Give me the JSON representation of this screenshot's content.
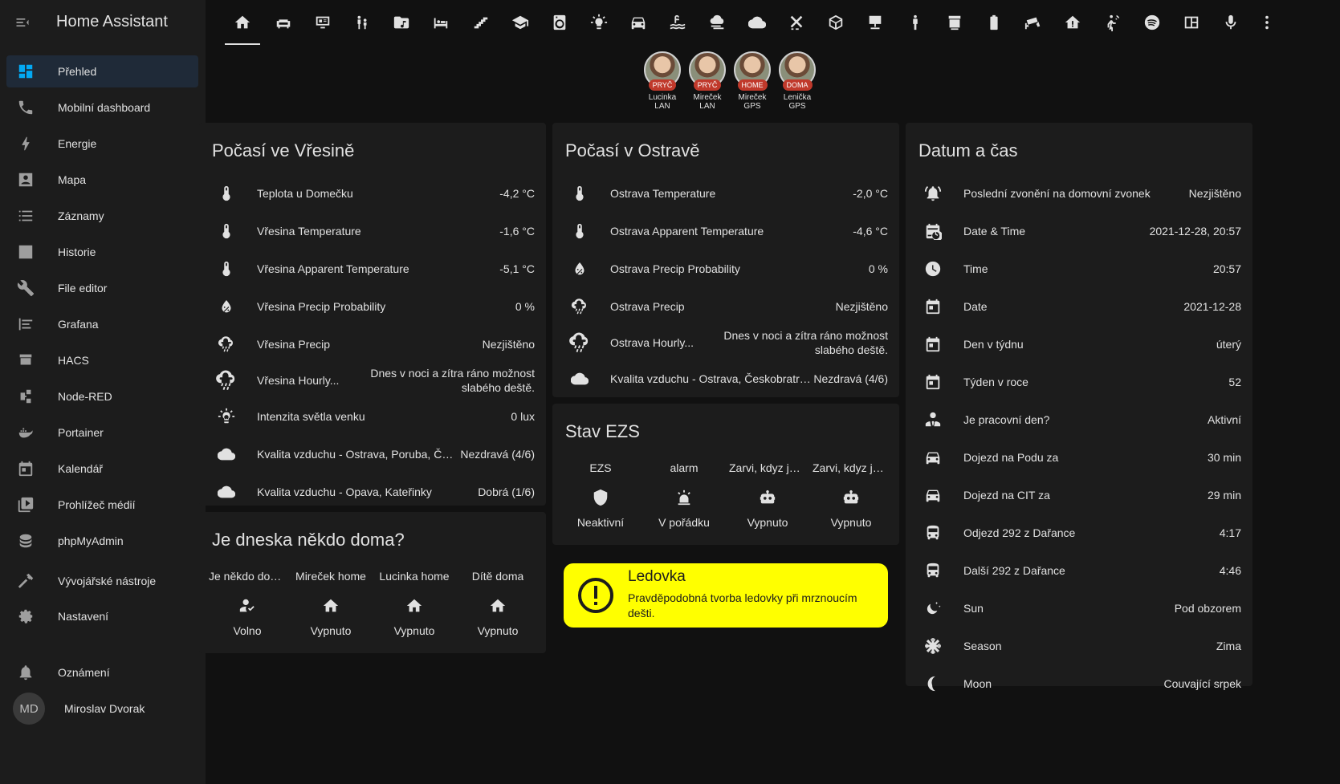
{
  "app": {
    "title": "Home Assistant"
  },
  "sidebar": {
    "items": [
      {
        "label": "Přehled",
        "icon": "dashboard-icon",
        "active": true
      },
      {
        "label": "Mobilní dashboard",
        "icon": "phone-icon"
      },
      {
        "label": "Energie",
        "icon": "lightning-icon"
      },
      {
        "label": "Mapa",
        "icon": "map-icon"
      },
      {
        "label": "Záznamy",
        "icon": "list-icon"
      },
      {
        "label": "Historie",
        "icon": "chart-icon"
      },
      {
        "label": "File editor",
        "icon": "wrench-icon"
      },
      {
        "label": "Grafana",
        "icon": "grafana-icon"
      },
      {
        "label": "HACS",
        "icon": "hacs-icon"
      },
      {
        "label": "Node-RED",
        "icon": "node-red-icon"
      },
      {
        "label": "Portainer",
        "icon": "whale-icon"
      },
      {
        "label": "Kalendář",
        "icon": "calendar-icon"
      },
      {
        "label": "Prohlížeč médií",
        "icon": "media-icon"
      },
      {
        "label": "phpMyAdmin",
        "icon": "database-icon"
      }
    ],
    "dev_tools": "Vývojářské nástroje",
    "settings": "Nastavení",
    "notifications": "Oznámení",
    "user_initials": "MD",
    "user_name": "Miroslav Dvorak"
  },
  "tabs": [
    "home-icon",
    "sofa-icon",
    "monitor-icon",
    "family-icon",
    "music-folder-icon",
    "bed-icon",
    "stairs-icon",
    "school-icon",
    "washer-icon",
    "bulb-icon",
    "car-icon",
    "pool-icon",
    "weather-wind-icon",
    "cloud-icon",
    "air-conditioner-icon",
    "cube-icon",
    "desk-icon",
    "person-icon",
    "printer-3d-icon",
    "battery-icon",
    "cctv-icon",
    "house-alert-icon",
    "motion-sensor-icon",
    "spotify-icon",
    "panel-icon",
    "microphone-icon"
  ],
  "badges": [
    {
      "state": "PRYČ",
      "name1": "Lucinka",
      "name2": "LAN"
    },
    {
      "state": "PRYČ",
      "name1": "Mireček",
      "name2": "LAN"
    },
    {
      "state": "HOME",
      "name1": "Mireček",
      "name2": "GPS"
    },
    {
      "state": "DOMA",
      "name1": "Lenička",
      "name2": "GPS"
    }
  ],
  "weather_vresina": {
    "title": "Počasí ve Vřesině",
    "rows": [
      {
        "icon": "thermometer-icon",
        "label": "Teplota u Domečku",
        "value": "-4,2 °C"
      },
      {
        "icon": "thermometer-icon",
        "label": "Vřesina Temperature",
        "value": "-1,6 °C"
      },
      {
        "icon": "thermometer-icon",
        "label": "Vřesina Apparent Temperature",
        "value": "-5,1 °C"
      },
      {
        "icon": "water-percent-icon",
        "label": "Vřesina Precip Probability",
        "value": "0 %"
      },
      {
        "icon": "weather-rainy-icon",
        "label": "Vřesina Precip",
        "value": "Nezjištěno"
      },
      {
        "icon": "weather-rainy-icon",
        "label": "Vřesina Hourly...",
        "value": "Dnes v noci a zítra ráno možnost slabého deště."
      },
      {
        "icon": "lightbulb-icon",
        "label": "Intenzita světla venku",
        "value": "0 lux"
      },
      {
        "icon": "cloud-icon",
        "label": "Kvalita vzduchu - Ostrava, Poruba, ČHMÚ",
        "value": "Nezdravá (4/6)"
      },
      {
        "icon": "cloud-icon",
        "label": "Kvalita vzduchu - Opava, Kateřinky",
        "value": "Dobrá (1/6)"
      }
    ]
  },
  "weather_ostrava": {
    "title": "Počasí v Ostravě",
    "rows": [
      {
        "icon": "thermometer-icon",
        "label": "Ostrava Temperature",
        "value": "-2,0 °C"
      },
      {
        "icon": "thermometer-icon",
        "label": "Ostrava Apparent Temperature",
        "value": "-4,6 °C"
      },
      {
        "icon": "water-percent-icon",
        "label": "Ostrava Precip Probability",
        "value": "0 %"
      },
      {
        "icon": "weather-rainy-icon",
        "label": "Ostrava Precip",
        "value": "Nezjištěno"
      },
      {
        "icon": "weather-rainy-icon",
        "label": "Ostrava Hourly...",
        "value": "Dnes v noci a zítra ráno možnost slabého deště."
      },
      {
        "icon": "cloud-icon",
        "label": "Kvalita vzduchu - Ostrava, Českobratrská",
        "value": "Nezdravá (4/6)"
      }
    ]
  },
  "home": {
    "title": "Je dneska někdo doma?",
    "items": [
      {
        "name": "Je někdo doma?",
        "icon": "account-check-icon",
        "state": "Volno"
      },
      {
        "name": "Mireček home",
        "icon": "home-icon",
        "state": "Vypnuto"
      },
      {
        "name": "Lucinka home",
        "icon": "home-icon",
        "state": "Vypnuto"
      },
      {
        "name": "Dítě doma",
        "icon": "home-icon",
        "state": "Vypnuto"
      }
    ]
  },
  "ezs": {
    "title": "Stav EZS",
    "items": [
      {
        "name": "EZS",
        "icon": "shield-icon",
        "state": "Neaktivní"
      },
      {
        "name": "alarm",
        "icon": "alarm-light-icon",
        "state": "V pořádku"
      },
      {
        "name": "Zarvi, kdyz je zvonek",
        "icon": "robot-icon",
        "state": "Vypnuto"
      },
      {
        "name": "Zarvi, kdyz je pohyb",
        "icon": "robot-icon",
        "state": "Vypnuto"
      }
    ]
  },
  "alert": {
    "title": "Ledovka",
    "text": "Pravděpodobná tvorba ledovky při mrznoucím dešti.",
    "color": "#ffff00"
  },
  "datetime": {
    "title": "Datum a čas",
    "rows": [
      {
        "icon": "bell-ring-icon",
        "label": "Poslední zvonění na domovní zvonek",
        "value": "Nezjištěno"
      },
      {
        "icon": "calendar-clock-icon",
        "label": "Date & Time",
        "value": "2021-12-28, 20:57"
      },
      {
        "icon": "clock-icon",
        "label": "Time",
        "value": "20:57"
      },
      {
        "icon": "calendar-icon",
        "label": "Date",
        "value": "2021-12-28"
      },
      {
        "icon": "calendar-icon",
        "label": "Den v týdnu",
        "value": "úterý"
      },
      {
        "icon": "calendar-icon",
        "label": "Týden v roce",
        "value": "52"
      },
      {
        "icon": "account-tie-icon",
        "label": "Je pracovní den?",
        "value": "Aktivní"
      },
      {
        "icon": "car-icon",
        "label": "Dojezd na Podu za",
        "value": "30 min"
      },
      {
        "icon": "car-icon",
        "label": "Dojezd na CIT za",
        "value": "29 min"
      },
      {
        "icon": "bus-icon",
        "label": "Odjezd 292 z Dařance",
        "value": "4:17"
      },
      {
        "icon": "bus-icon",
        "label": "Další 292 z Dařance",
        "value": "4:46"
      },
      {
        "icon": "weather-night-icon",
        "label": "Sun",
        "value": "Pod obzorem"
      },
      {
        "icon": "snowflake-icon",
        "label": "Season",
        "value": "Zima"
      },
      {
        "icon": "moon-icon",
        "label": "Moon",
        "value": "Couvající srpek"
      }
    ]
  },
  "colors": {
    "accent": "#03a9f4",
    "card": "#1c1c1c",
    "background": "#111111",
    "badge_away": "#c0392b"
  }
}
